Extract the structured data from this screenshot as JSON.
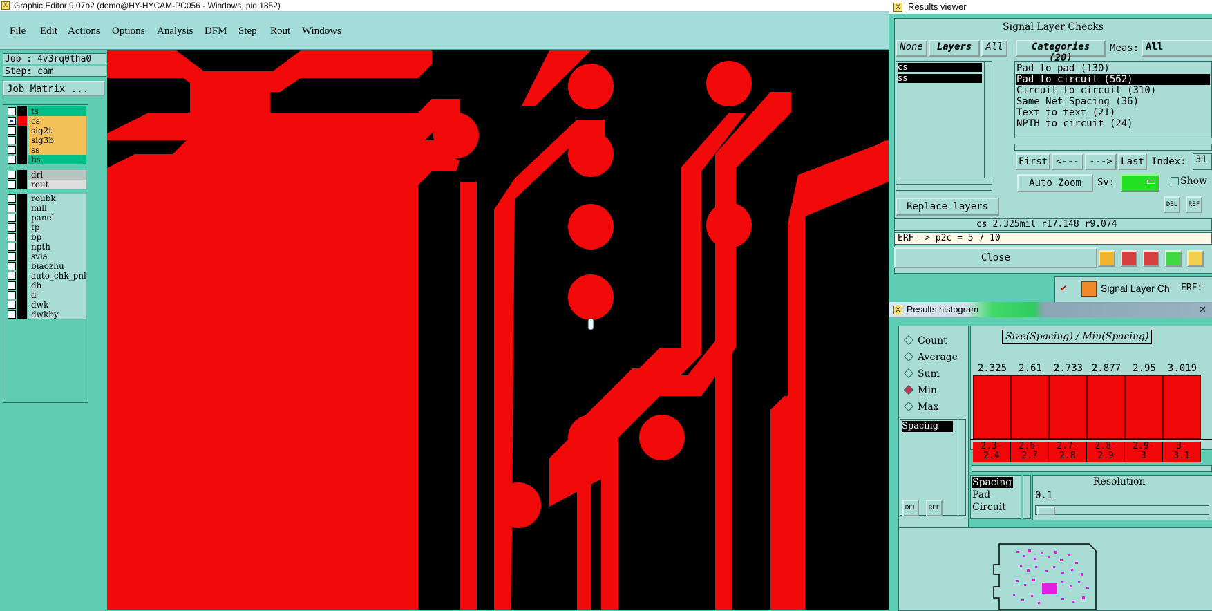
{
  "main_window": {
    "title": "Graphic Editor 9.07b2 (demo@HY-HYCAM-PC056 - Windows, pid:1852)",
    "menu": [
      "File",
      "Edit",
      "Actions",
      "Options",
      "Analysis",
      "DFM",
      "Step",
      "Rout",
      "Windows"
    ]
  },
  "left_panel": {
    "job": "Job : 4v3rq0tha0",
    "step": "Step: cam",
    "job_matrix": "Job Matrix ..."
  },
  "layers": [
    {
      "name": "ts",
      "color": "#00c08a",
      "selected": false
    },
    {
      "name": "cs",
      "color": "#f5c25a",
      "selected": true,
      "swatch": "#ff0000"
    },
    {
      "name": "sig2t",
      "color": "#f5c25a",
      "selected": false
    },
    {
      "name": "sig3b",
      "color": "#f5c25a",
      "selected": false
    },
    {
      "name": "ss",
      "color": "#f5c25a",
      "selected": false
    },
    {
      "name": "bs",
      "color": "#00c08a",
      "selected": false
    },
    {
      "name": "drl",
      "color": "#b8c4c0",
      "selected": false
    },
    {
      "name": "rout",
      "color": "#dedede",
      "selected": false
    },
    {
      "name": "roubk",
      "color": "#a8dcd4",
      "selected": false
    },
    {
      "name": "mill",
      "color": "#a8dcd4",
      "selected": false
    },
    {
      "name": "panel",
      "color": "#a8dcd4",
      "selected": false
    },
    {
      "name": "tp",
      "color": "#a8dcd4",
      "selected": false
    },
    {
      "name": "bp",
      "color": "#a8dcd4",
      "selected": false
    },
    {
      "name": "npth",
      "color": "#a8dcd4",
      "selected": false
    },
    {
      "name": "svia",
      "color": "#a8dcd4",
      "selected": false
    },
    {
      "name": "biaozhu",
      "color": "#a8dcd4",
      "selected": false
    },
    {
      "name": "auto_chk_pnl",
      "color": "#a8dcd4",
      "selected": false
    },
    {
      "name": "dh",
      "color": "#a8dcd4",
      "selected": false
    },
    {
      "name": "d",
      "color": "#a8dcd4",
      "selected": false
    },
    {
      "name": "dwk",
      "color": "#a8dcd4",
      "selected": false
    },
    {
      "name": "dwkby",
      "color": "#a8dcd4",
      "selected": false
    }
  ],
  "results_viewer": {
    "title": "Results viewer",
    "header": "Signal Layer Checks",
    "none_label": "None",
    "layers_label": "Layers",
    "all_label": "All",
    "categories_label": "Categories (20)",
    "meas_label": "Meas:",
    "meas_value": "All",
    "layer_items": [
      "cs",
      "ss"
    ],
    "categories": [
      {
        "label": "Pad to pad (130)",
        "selected": false
      },
      {
        "label": "Pad to circuit (562)",
        "selected": true
      },
      {
        "label": "Circuit to circuit (310)",
        "selected": false
      },
      {
        "label": "Same Net Spacing (36)",
        "selected": false
      },
      {
        "label": "Text to text (21)",
        "selected": false
      },
      {
        "label": "NPTH to circuit (24)",
        "selected": false
      }
    ],
    "nav": {
      "first": "First",
      "prev": "<---",
      "next": "--->",
      "last": "Last",
      "index_label": "Index:",
      "index_value": "31"
    },
    "auto_zoom": "Auto Zoom",
    "sv_label": "Sv:",
    "show_label": "Show",
    "replace_layers": "Replace layers",
    "measure_text": "cs 2.325mil  r17.148  r9.074",
    "erf_text": "ERF--> p2c = 5 7 10",
    "close": "Close",
    "del": "DEL",
    "ref": "REF"
  },
  "taskbar_item": {
    "label": "Signal Layer Ch",
    "erf": "ERF:"
  },
  "histogram": {
    "title": "Results histogram",
    "modes": [
      {
        "label": "Count",
        "on": false
      },
      {
        "label": "Average",
        "on": false
      },
      {
        "label": "Sum",
        "on": false
      },
      {
        "label": "Min",
        "on": true
      },
      {
        "label": "Max",
        "on": false
      }
    ],
    "list_item": "Spacing",
    "formula": "Size(Spacing) / Min(Spacing)",
    "bar_values": [
      "2.325",
      "2.61",
      "2.733",
      "2.877",
      "2.95",
      "3.019"
    ],
    "bins": [
      [
        "2.3-",
        "2.4"
      ],
      [
        "2.6-",
        "2.7"
      ],
      [
        "2.7-",
        "2.8"
      ],
      [
        "2.8-",
        "2.9"
      ],
      [
        "2.9-",
        "3"
      ],
      [
        "3-",
        "3.1"
      ]
    ],
    "meas_list": [
      {
        "label": "Spacing",
        "selected": true
      },
      {
        "label": "Pad",
        "selected": false
      },
      {
        "label": "Circuit",
        "selected": false
      }
    ],
    "resolution_label": "Resolution",
    "resolution_value": "0.1",
    "del": "DEL",
    "ref": "REF"
  },
  "colors": {
    "copper": "#f20a0a",
    "background": "#000000",
    "panel": "#a8dcd4",
    "frame": "#5fcdb4"
  }
}
